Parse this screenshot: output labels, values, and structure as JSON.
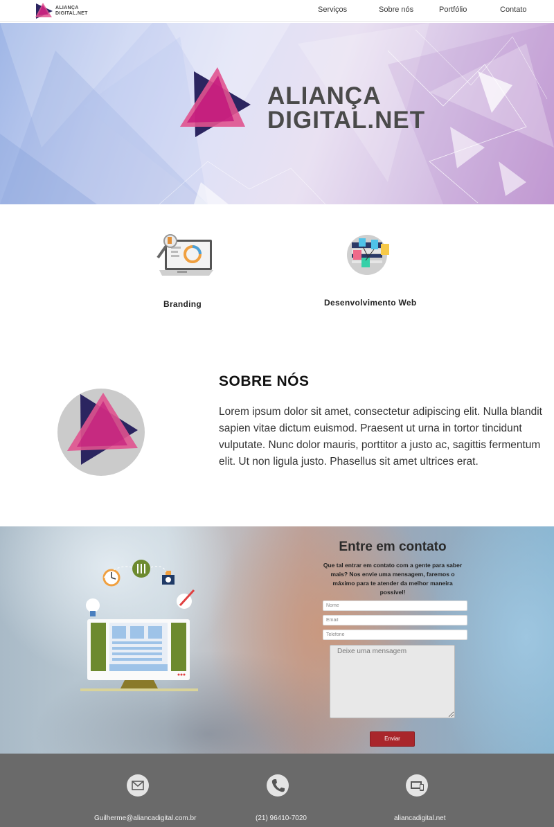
{
  "brand": {
    "nav_logo_line1": "ALIANÇA",
    "nav_logo_line2": "DIGITAL.NET",
    "hero_line1": "ALIANÇA",
    "hero_line2": "DIGITAL.NET",
    "colors": {
      "magenta": "#c2127a",
      "navy": "#2b2560",
      "pink": "#e0538f"
    }
  },
  "nav": {
    "links": [
      "Serviços",
      "Sobre nós",
      "Portfólio",
      "Contato"
    ]
  },
  "services": [
    {
      "label": "Branding",
      "icon": "laptop-analytics-icon"
    },
    {
      "label": "Desenvolvimento Web",
      "icon": "web-development-icon"
    }
  ],
  "about": {
    "title": "SOBRE NÓS",
    "text": "Lorem ipsum dolor sit amet, consectetur adipiscing elit. Nulla blandit sapien vitae dictum euismod. Praesent ut urna in tortor tincidunt vulputate. Nunc dolor mauris, porttitor a justo ac, sagittis fermentum elit. Ut non ligula justo. Phasellus sit amet ultrices erat."
  },
  "contact": {
    "title": "Entre em contato",
    "subtitle": "Que tal entrar em contato com a gente para saber mais? Nos envie uma mensagem, faremos o máximo para te atender da melhor maneira possível!",
    "name_placeholder": "Nome",
    "email_placeholder": "Email",
    "phone_placeholder": "Telefone",
    "message_placeholder": "Deixe uma mensagem",
    "send_label": "Enviar",
    "send_color": "#a9262b"
  },
  "footer": {
    "email": "Guilherme@aliancadigital.com.br",
    "phone": "(21) 96410-7020",
    "site": "aliancadigital.net",
    "icons": [
      "envelope-icon",
      "phone-icon",
      "devices-icon"
    ]
  }
}
